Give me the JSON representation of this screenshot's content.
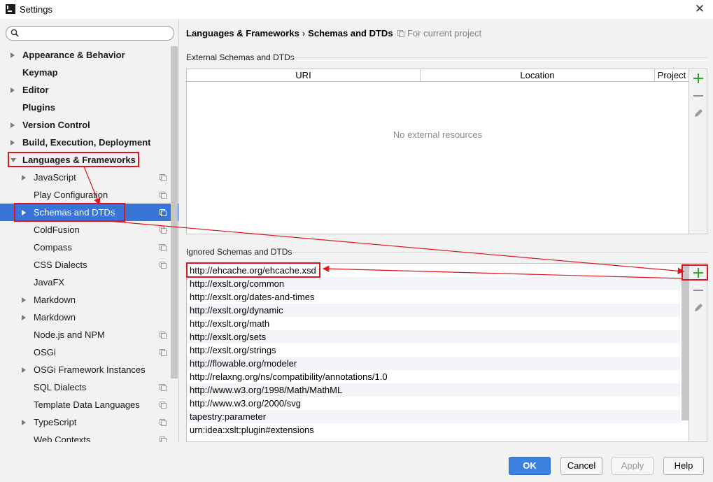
{
  "window": {
    "title": "Settings",
    "close_glyph": "✕"
  },
  "search": {
    "placeholder": "",
    "icon": "search-icon"
  },
  "tree": [
    {
      "label": "Appearance & Behavior",
      "level": 0,
      "bold": true,
      "arrow": "right",
      "proj": false
    },
    {
      "label": "Keymap",
      "level": 0,
      "bold": true,
      "arrow": "none",
      "proj": false
    },
    {
      "label": "Editor",
      "level": 0,
      "bold": true,
      "arrow": "right",
      "proj": false
    },
    {
      "label": "Plugins",
      "level": 0,
      "bold": true,
      "arrow": "none",
      "proj": false
    },
    {
      "label": "Version Control",
      "level": 0,
      "bold": true,
      "arrow": "right",
      "proj": false
    },
    {
      "label": "Build, Execution, Deployment",
      "level": 0,
      "bold": true,
      "arrow": "right",
      "proj": false
    },
    {
      "label": "Languages & Frameworks",
      "level": 0,
      "bold": true,
      "arrow": "down",
      "proj": false
    },
    {
      "label": "JavaScript",
      "level": 1,
      "bold": false,
      "arrow": "right",
      "proj": true
    },
    {
      "label": "Play Configuration",
      "level": 1,
      "bold": false,
      "arrow": "none",
      "proj": true
    },
    {
      "label": "Schemas and DTDs",
      "level": 1,
      "bold": false,
      "arrow": "right",
      "proj": true,
      "selected": true
    },
    {
      "label": "ColdFusion",
      "level": 1,
      "bold": false,
      "arrow": "none",
      "proj": true
    },
    {
      "label": "Compass",
      "level": 1,
      "bold": false,
      "arrow": "none",
      "proj": true
    },
    {
      "label": "CSS Dialects",
      "level": 1,
      "bold": false,
      "arrow": "none",
      "proj": true
    },
    {
      "label": "JavaFX",
      "level": 1,
      "bold": false,
      "arrow": "none",
      "proj": false
    },
    {
      "label": "Markdown",
      "level": 1,
      "bold": false,
      "arrow": "right",
      "proj": false
    },
    {
      "label": "Markdown",
      "level": 1,
      "bold": false,
      "arrow": "right",
      "proj": false
    },
    {
      "label": "Node.js and NPM",
      "level": 1,
      "bold": false,
      "arrow": "none",
      "proj": true
    },
    {
      "label": "OSGi",
      "level": 1,
      "bold": false,
      "arrow": "none",
      "proj": true
    },
    {
      "label": "OSGi Framework Instances",
      "level": 1,
      "bold": false,
      "arrow": "right",
      "proj": false
    },
    {
      "label": "SQL Dialects",
      "level": 1,
      "bold": false,
      "arrow": "none",
      "proj": true
    },
    {
      "label": "Template Data Languages",
      "level": 1,
      "bold": false,
      "arrow": "none",
      "proj": true
    },
    {
      "label": "TypeScript",
      "level": 1,
      "bold": false,
      "arrow": "right",
      "proj": true
    },
    {
      "label": "Web Contexts",
      "level": 1,
      "bold": false,
      "arrow": "none",
      "proj": true
    }
  ],
  "header": {
    "crumb1": "Languages & Frameworks",
    "sep": "›",
    "crumb2": "Schemas and DTDs",
    "project_note": "For current project"
  },
  "external": {
    "group_label": "External Schemas and DTDs",
    "columns": [
      "URI",
      "Location",
      "Project"
    ],
    "empty_text": "No external resources"
  },
  "ignored": {
    "group_label": "Ignored Schemas and DTDs",
    "items": [
      "http://ehcache.org/ehcache.xsd",
      "http://exslt.org/common",
      "http://exslt.org/dates-and-times",
      "http://exslt.org/dynamic",
      "http://exslt.org/math",
      "http://exslt.org/sets",
      "http://exslt.org/strings",
      "http://flowable.org/modeler",
      "http://relaxng.org/ns/compatibility/annotations/1.0",
      "http://www.w3.org/1998/Math/MathML",
      "http://www.w3.org/2000/svg",
      "tapestry:parameter",
      "urn:idea:xslt:plugin#extensions"
    ]
  },
  "buttons": {
    "ok": "OK",
    "cancel": "Cancel",
    "apply": "Apply",
    "help": "Help"
  },
  "colors": {
    "selection": "#3875d6",
    "annotation": "#e0141e",
    "add": "#31a331",
    "primary": "#3b82e0"
  }
}
